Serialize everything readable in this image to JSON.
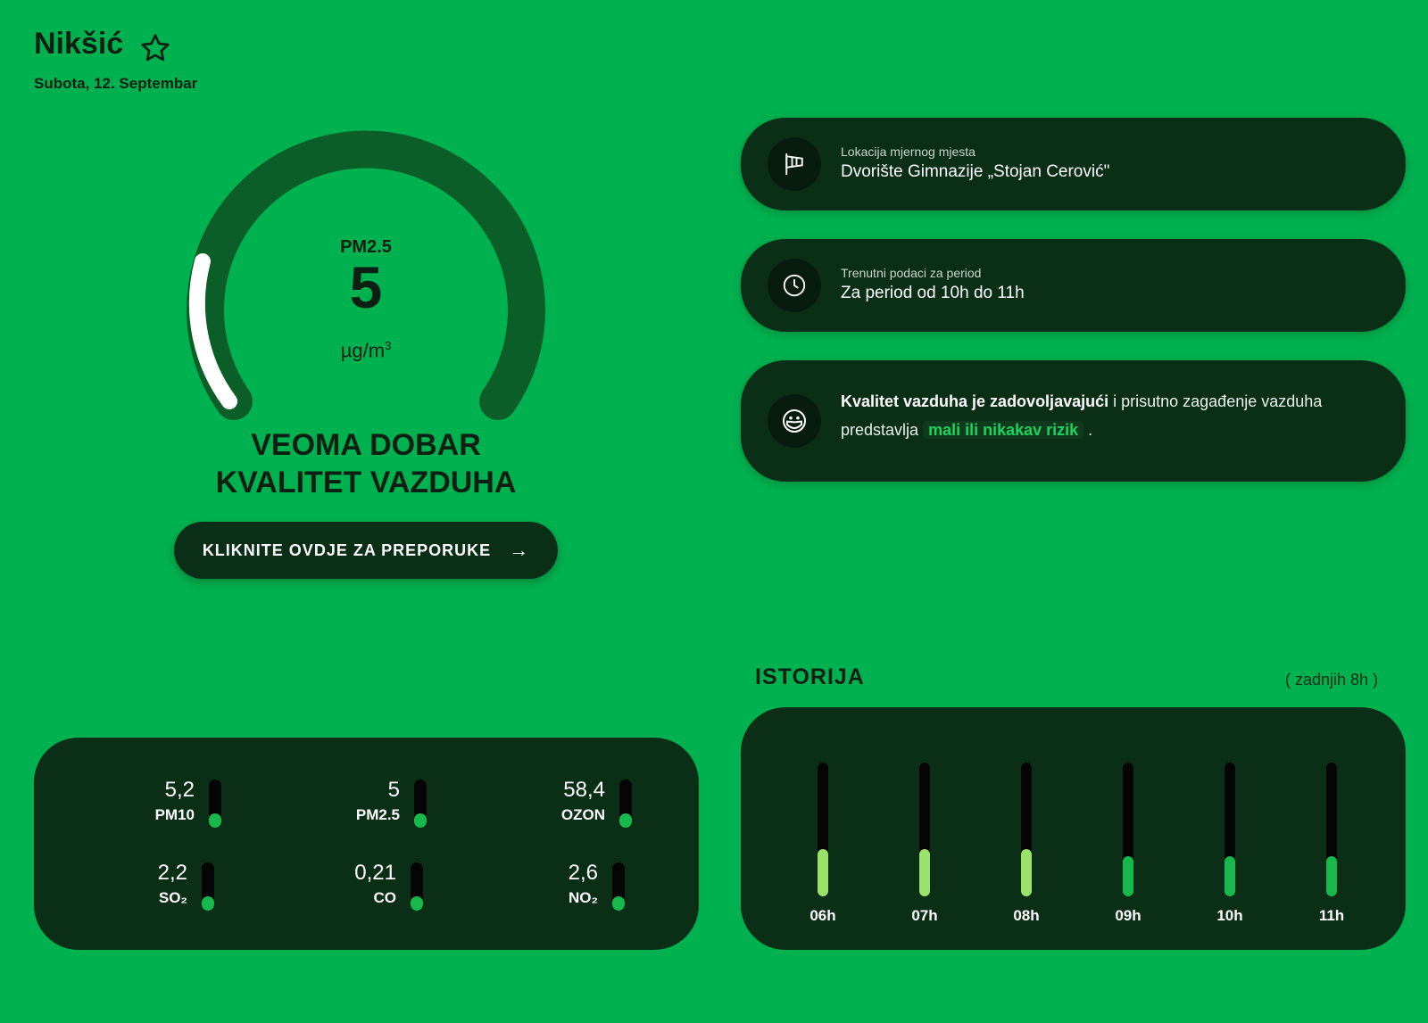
{
  "header": {
    "city": "Nikšić",
    "date": "Subota, 12. Septembar"
  },
  "gauge": {
    "pollutant": "PM2.5",
    "value": "5",
    "unit": "µg/m",
    "unit_sup": "3",
    "level_fraction": 0.14,
    "status_line1": "VEOMA DOBAR",
    "status_line2": "KVALITET VAZDUHA"
  },
  "cta": {
    "label": "KLIKNITE OVDJE ZA PREPORUKE",
    "arrow": "→"
  },
  "cards": {
    "location": {
      "label": "Lokacija mjernog mjesta",
      "value": "Dvorište Gimnazije „Stojan Cerović\""
    },
    "period": {
      "label": "Trenutni podaci za period",
      "value": "Za period od 10h do 11h"
    },
    "quality": {
      "bold": "Kvalitet vazduha je zadovoljavajući",
      "text1": " i prisutno zagađenje vazduha predstavlja ",
      "highlight": "mali ili nikakav rizik",
      "text2": " ."
    }
  },
  "pollutants": [
    {
      "name": "PM10",
      "value": "5,2",
      "level": 0.3
    },
    {
      "name": "PM2.5",
      "value": "5",
      "level": 0.3
    },
    {
      "name": "OZON",
      "value": "58,4",
      "level": 0.3
    },
    {
      "name": "SO₂",
      "value": "2,2",
      "level": 0.3
    },
    {
      "name": "CO",
      "value": "0,21",
      "level": 0.3
    },
    {
      "name": "NO₂",
      "value": "2,6",
      "level": 0.3
    }
  ],
  "history": {
    "title": "ISTORIJA",
    "note": "( zadnjih 8h )",
    "bars": [
      {
        "hour": "06h",
        "level": 0.35,
        "color": "#9be26a"
      },
      {
        "hour": "07h",
        "level": 0.35,
        "color": "#9be26a"
      },
      {
        "hour": "08h",
        "level": 0.35,
        "color": "#9be26a"
      },
      {
        "hour": "09h",
        "level": 0.3,
        "color": "#19b84d"
      },
      {
        "hour": "10h",
        "level": 0.3,
        "color": "#19b84d"
      },
      {
        "hour": "11h",
        "level": 0.3,
        "color": "#19b84d"
      }
    ]
  },
  "colors": {
    "background": "#00b14f",
    "panel": "#0b2e16",
    "accent": "#19b84d"
  }
}
